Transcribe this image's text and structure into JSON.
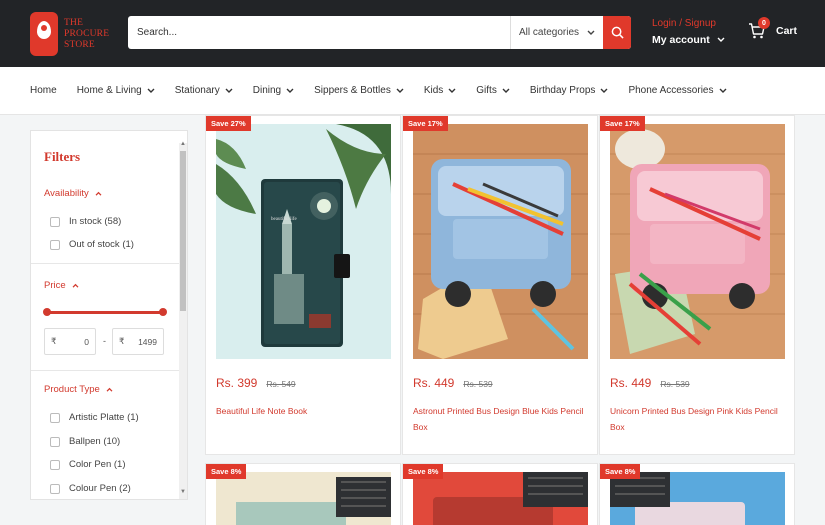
{
  "brand": {
    "name_line1": "THE",
    "name_line2": "PROCURE",
    "name_line3": "STORE"
  },
  "search": {
    "placeholder": "Search...",
    "category": "All categories"
  },
  "account": {
    "login": "Login / Signup",
    "my_account": "My account"
  },
  "cart": {
    "label": "Cart",
    "count": "0"
  },
  "nav": [
    {
      "label": "Home",
      "has_dropdown": false
    },
    {
      "label": "Home & Living",
      "has_dropdown": true
    },
    {
      "label": "Stationary",
      "has_dropdown": true
    },
    {
      "label": "Dining",
      "has_dropdown": true
    },
    {
      "label": "Sippers & Bottles",
      "has_dropdown": true
    },
    {
      "label": "Kids",
      "has_dropdown": true
    },
    {
      "label": "Gifts",
      "has_dropdown": true
    },
    {
      "label": "Birthday Props",
      "has_dropdown": true
    },
    {
      "label": "Phone Accessories",
      "has_dropdown": true
    }
  ],
  "filters": {
    "title": "Filters",
    "availability": {
      "label": "Availability",
      "options": [
        "In stock (58)",
        "Out of stock (1)"
      ]
    },
    "price": {
      "label": "Price",
      "currency": "₹",
      "min": "0",
      "max": "1499",
      "dash": "-"
    },
    "product_type": {
      "label": "Product Type",
      "options": [
        "Artistic Platte (1)",
        "Ballpen (10)",
        "Color Pen (1)",
        "Colour Pen (2)"
      ]
    }
  },
  "products": [
    {
      "save": "Save 27%",
      "price": "Rs. 399",
      "old_price": "Rs. 549",
      "title": "Beautiful Life Note Book"
    },
    {
      "save": "Save 17%",
      "price": "Rs. 449",
      "old_price": "Rs. 539",
      "title": "Astronut Printed Bus Design Blue Kids Pencil Box"
    },
    {
      "save": "Save 17%",
      "price": "Rs. 449",
      "old_price": "Rs. 539",
      "title": "Unicorn Printed Bus Design Pink Kids Pencil Box"
    },
    {
      "save": "Save 8%"
    },
    {
      "save": "Save 8%"
    },
    {
      "save": "Save 8%"
    }
  ],
  "colors": {
    "accent": "#e0392b",
    "header_bg": "#222427"
  }
}
